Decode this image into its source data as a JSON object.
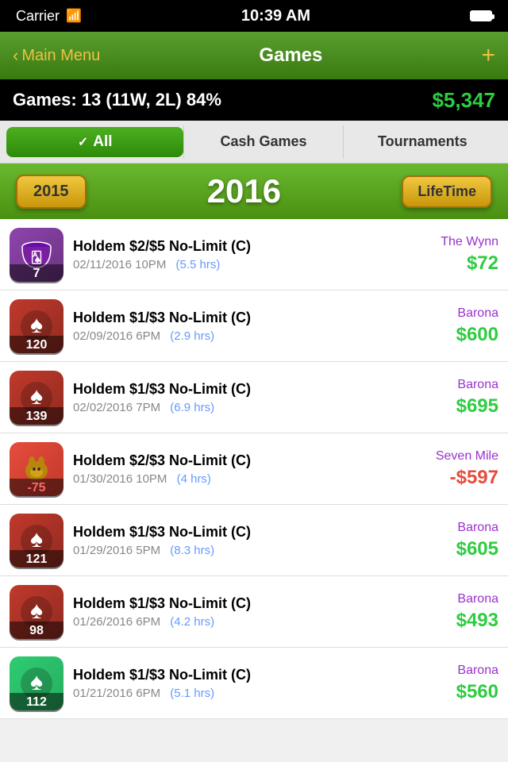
{
  "status": {
    "carrier": "Carrier",
    "wifi": true,
    "time": "10:39 AM",
    "battery_full": true
  },
  "nav": {
    "back_label": "Main Menu",
    "title": "Games",
    "add_label": "+"
  },
  "stats": {
    "label": "Games: 13 (11W, 2L) 84%",
    "money": "$5,347"
  },
  "filters": {
    "all_label": "All",
    "cash_label": "Cash Games",
    "tournaments_label": "Tournaments"
  },
  "year_selector": {
    "prev_year": "2015",
    "current_year": "2016",
    "lifetime_label": "LifeTime"
  },
  "games": [
    {
      "id": 1,
      "icon_type": "bucket",
      "number": "7",
      "negative": false,
      "title": "Holdem $2/$5 No-Limit (C)",
      "date": "02/11/2016 10PM",
      "hours": "(5.5 hrs)",
      "venue": "The Wynn",
      "amount": "$72",
      "amount_negative": false
    },
    {
      "id": 2,
      "icon_type": "spade",
      "number": "120",
      "negative": false,
      "title": "Holdem $1/$3 No-Limit (C)",
      "date": "02/09/2016 6PM",
      "hours": "(2.9 hrs)",
      "venue": "Barona",
      "amount": "$600",
      "amount_negative": false
    },
    {
      "id": 3,
      "icon_type": "spade",
      "number": "139",
      "negative": false,
      "title": "Holdem $1/$3 No-Limit (C)",
      "date": "02/02/2016 7PM",
      "hours": "(6.9 hrs)",
      "venue": "Barona",
      "amount": "$695",
      "amount_negative": false
    },
    {
      "id": 4,
      "icon_type": "donkey",
      "number": "-75",
      "negative": true,
      "title": "Holdem $2/$3 No-Limit (C)",
      "date": "01/30/2016 10PM",
      "hours": "(4 hrs)",
      "venue": "Seven Mile",
      "amount": "-$597",
      "amount_negative": true
    },
    {
      "id": 5,
      "icon_type": "spade",
      "number": "121",
      "negative": false,
      "title": "Holdem $1/$3 No-Limit (C)",
      "date": "01/29/2016 5PM",
      "hours": "(8.3 hrs)",
      "venue": "Barona",
      "amount": "$605",
      "amount_negative": false
    },
    {
      "id": 6,
      "icon_type": "spade",
      "number": "98",
      "negative": false,
      "title": "Holdem $1/$3 No-Limit (C)",
      "date": "01/26/2016 6PM",
      "hours": "(4.2 hrs)",
      "venue": "Barona",
      "amount": "$493",
      "amount_negative": false
    },
    {
      "id": 7,
      "icon_type": "spade_green",
      "number": "112",
      "negative": false,
      "title": "Holdem $1/$3 No-Limit (C)",
      "date": "01/21/2016 6PM",
      "hours": "(5.1 hrs)",
      "venue": "Barona",
      "amount": "$560",
      "amount_negative": false
    }
  ]
}
